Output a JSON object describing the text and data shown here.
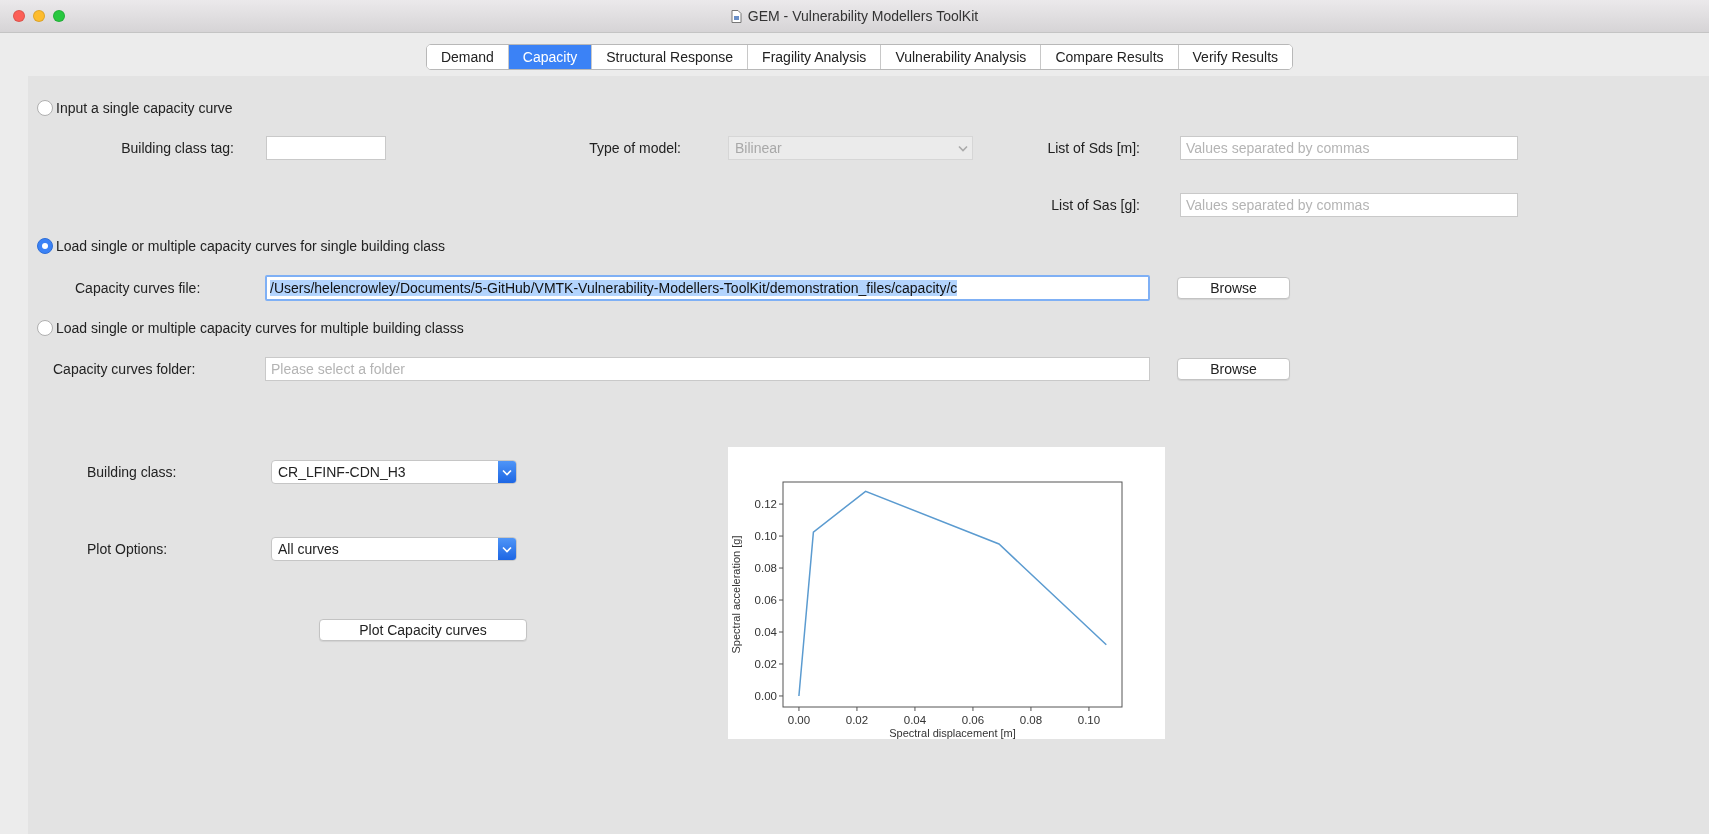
{
  "window": {
    "title": "GEM - Vulnerability Modellers ToolKit"
  },
  "tabs": [
    {
      "label": "Demand",
      "selected": false
    },
    {
      "label": "Capacity",
      "selected": true
    },
    {
      "label": "Structural Response",
      "selected": false
    },
    {
      "label": "Fragility Analysis",
      "selected": false
    },
    {
      "label": "Vulnerability Analysis",
      "selected": false
    },
    {
      "label": "Compare Results",
      "selected": false
    },
    {
      "label": "Verify Results",
      "selected": false
    }
  ],
  "source_options": [
    {
      "label": "Input a single capacity curve",
      "selected": false
    },
    {
      "label": "Load single or multiple capacity curves for single building class",
      "selected": true
    },
    {
      "label": "Load single or multiple capacity curves for multiple building classs",
      "selected": false
    }
  ],
  "single_curve": {
    "building_class_tag": {
      "label": "Building class tag:"
    },
    "type_of_model": {
      "label": "Type of model:",
      "value": "Bilinear",
      "disabled": true
    },
    "sds": {
      "label": "List of Sds [m]:",
      "placeholder": "Values separated by commas"
    },
    "sas": {
      "label": "List of Sas [g]:",
      "placeholder": "Values separated by commas"
    }
  },
  "single_class": {
    "label": "Capacity curves file:",
    "value": "/Users/helencrowley/Documents/5-GitHub/VMTK-Vulnerability-Modellers-ToolKit/demonstration_files/capacity/c",
    "text_selected": true,
    "button": "Browse"
  },
  "multiple_classes": {
    "label": "Capacity curves folder:",
    "placeholder": "Please select a folder",
    "button": "Browse"
  },
  "plot": {
    "building_class": {
      "label": "Building class:",
      "value": "CR_LFINF-CDN_H3"
    },
    "plot_options": {
      "label": "Plot Options:",
      "value": "All curves"
    },
    "button": "Plot Capacity curves",
    "chart_data": {
      "type": "line",
      "xlabel": "Spectral displacement [m]",
      "ylabel": "Spectral acceleration [g]",
      "x": [
        0,
        0.005,
        0.023,
        0.069,
        0.106
      ],
      "series": [
        {
          "color": "#5b9bd0",
          "values": [
            0,
            0.1025,
            0.128,
            0.095,
            0.032
          ]
        }
      ],
      "xlim": [
        -0.0055,
        0.1114
      ],
      "ylim": [
        -0.0069,
        0.1338
      ],
      "xticks": [
        {
          "value": 0,
          "label": "0.00"
        },
        {
          "value": 0.02,
          "label": "0.02"
        },
        {
          "value": 0.04,
          "label": "0.04"
        },
        {
          "value": 0.06,
          "label": "0.06"
        },
        {
          "value": 0.08,
          "label": "0.08"
        },
        {
          "value": 0.1,
          "label": "0.10"
        }
      ],
      "yticks": [
        {
          "value": 0,
          "label": "0.00"
        },
        {
          "value": 0.02,
          "label": "0.02"
        },
        {
          "value": 0.04,
          "label": "0.04"
        },
        {
          "value": 0.06,
          "label": "0.06"
        },
        {
          "value": 0.08,
          "label": "0.08"
        },
        {
          "value": 0.1,
          "label": "0.10"
        },
        {
          "value": 0.12,
          "label": "0.12"
        }
      ]
    }
  }
}
